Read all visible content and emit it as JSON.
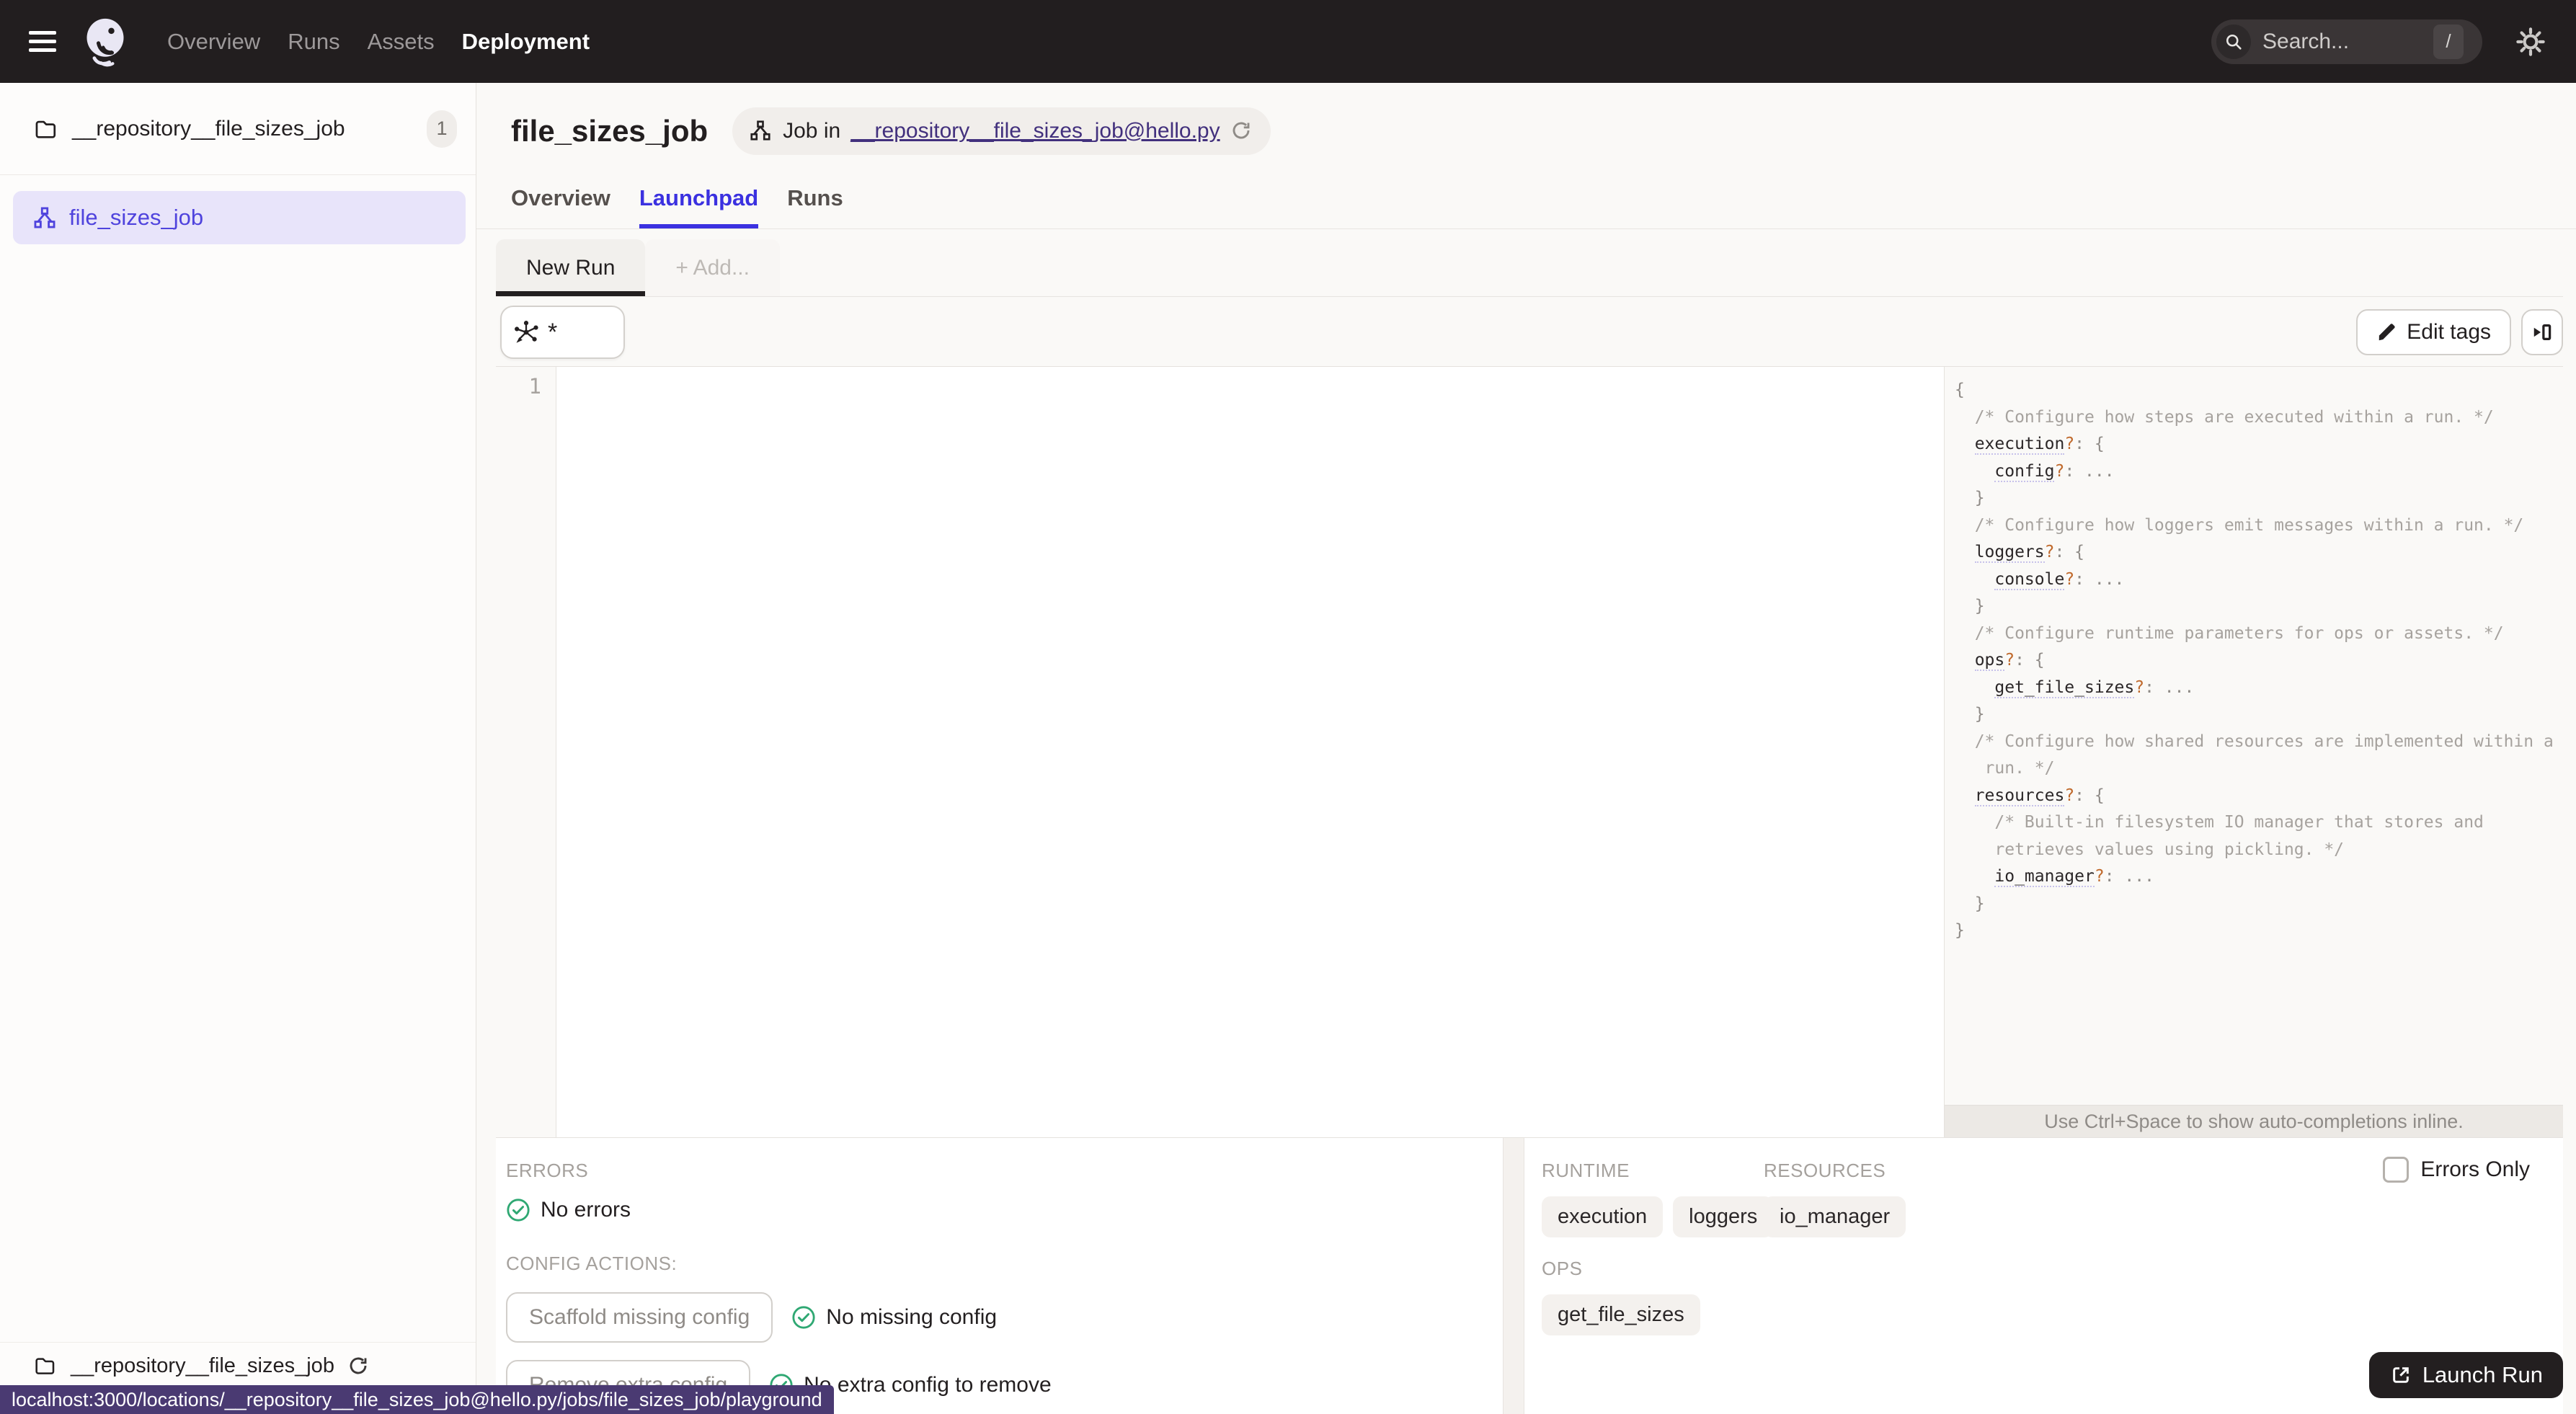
{
  "colors": {
    "topnav_bg": "#221E1F",
    "page_bg": "#FAF9F7",
    "border": "#E5E2DE",
    "accent": "#3B31E0",
    "blurple": "#4F43DD",
    "selected_bg": "#E8E4FA",
    "link_purple": "#42307D",
    "statusbar_bg": "#4A3A72",
    "success": "#2FA873",
    "dark": "#231F20",
    "muted": "#A5A19D",
    "code_comment": "#A6A29E",
    "code_punct": "#8F8B87",
    "code_qmark": "#C06A2D"
  },
  "topnav": {
    "items": [
      {
        "label": "Overview"
      },
      {
        "label": "Runs"
      },
      {
        "label": "Assets"
      },
      {
        "label": "Deployment"
      }
    ],
    "search": {
      "placeholder": "Search...",
      "shortcut": "/"
    }
  },
  "sidebar": {
    "repository": {
      "name": "__repository__file_sizes_job",
      "count": "1"
    },
    "job": {
      "name": "file_sizes_job"
    },
    "footer_repository": "__repository__file_sizes_job"
  },
  "header": {
    "title": "file_sizes_job",
    "job_pill": {
      "prefix": "Job in",
      "link": "__repository__file_sizes_job@hello.py"
    }
  },
  "tabs": [
    {
      "label": "Overview"
    },
    {
      "label": "Launchpad"
    },
    {
      "label": "Runs"
    }
  ],
  "launchpad": {
    "config_tabs": [
      {
        "label": "New Run"
      },
      {
        "label": "+ Add..."
      }
    ],
    "op_selector": "*",
    "edit_tags": "Edit tags",
    "editor": {
      "first_line_number": "1"
    },
    "schema_panel": {
      "hint": "Use Ctrl+Space to show auto-completions inline.",
      "lines": [
        {
          "i": 0,
          "toks": [
            [
              "p",
              "{"
            ]
          ]
        },
        {
          "i": 2,
          "toks": [
            [
              "c",
              "/* Configure how steps are executed within a run. */"
            ]
          ]
        },
        {
          "i": 2,
          "toks": [
            [
              "k",
              "execution"
            ],
            [
              "q",
              "?"
            ],
            [
              "p",
              ": {"
            ]
          ]
        },
        {
          "i": 4,
          "toks": [
            [
              "k",
              "config"
            ],
            [
              "q",
              "?"
            ],
            [
              "p",
              ": ..."
            ]
          ]
        },
        {
          "i": 2,
          "toks": [
            [
              "p",
              "}"
            ]
          ]
        },
        {
          "i": 2,
          "toks": [
            [
              "c",
              "/* Configure how loggers emit messages within a run. */"
            ]
          ]
        },
        {
          "i": 2,
          "toks": [
            [
              "k",
              "loggers"
            ],
            [
              "q",
              "?"
            ],
            [
              "p",
              ": {"
            ]
          ]
        },
        {
          "i": 4,
          "toks": [
            [
              "k",
              "console"
            ],
            [
              "q",
              "?"
            ],
            [
              "p",
              ": ..."
            ]
          ]
        },
        {
          "i": 2,
          "toks": [
            [
              "p",
              "}"
            ]
          ]
        },
        {
          "i": 2,
          "toks": [
            [
              "c",
              "/* Configure runtime parameters for ops or assets. */"
            ]
          ]
        },
        {
          "i": 2,
          "toks": [
            [
              "k",
              "ops"
            ],
            [
              "q",
              "?"
            ],
            [
              "p",
              ": {"
            ]
          ]
        },
        {
          "i": 4,
          "toks": [
            [
              "k",
              "get_file_sizes"
            ],
            [
              "q",
              "?"
            ],
            [
              "p",
              ": ..."
            ]
          ]
        },
        {
          "i": 2,
          "toks": [
            [
              "p",
              "}"
            ]
          ]
        },
        {
          "i": 2,
          "toks": [
            [
              "c",
              "/* Configure how shared resources are implemented within a"
            ]
          ]
        },
        {
          "i": 3,
          "toks": [
            [
              "c",
              "run. */"
            ]
          ]
        },
        {
          "i": 2,
          "toks": [
            [
              "k",
              "resources"
            ],
            [
              "q",
              "?"
            ],
            [
              "p",
              ": {"
            ]
          ]
        },
        {
          "i": 4,
          "toks": [
            [
              "c",
              "/* Built-in filesystem IO manager that stores and"
            ]
          ]
        },
        {
          "i": 4,
          "toks": [
            [
              "c",
              "retrieves values using pickling. */"
            ]
          ]
        },
        {
          "i": 4,
          "toks": [
            [
              "k",
              "io_manager"
            ],
            [
              "q",
              "?"
            ],
            [
              "p",
              ": ..."
            ]
          ]
        },
        {
          "i": 2,
          "toks": [
            [
              "p",
              "}"
            ]
          ]
        },
        {
          "i": 0,
          "toks": [
            [
              "p",
              "}"
            ]
          ]
        }
      ]
    },
    "bottom": {
      "errors_label": "ERRORS",
      "no_errors": "No errors",
      "config_actions_label": "CONFIG ACTIONS:",
      "scaffold_button": "Scaffold missing config",
      "no_missing_config": "No missing config",
      "remove_button": "Remove extra config",
      "no_extra_config": "No extra config to remove",
      "runtime_label": "RUNTIME",
      "runtime_tags": [
        "execution",
        "loggers"
      ],
      "resources_label": "RESOURCES",
      "resources_tags": [
        "io_manager"
      ],
      "ops_label": "OPS",
      "ops_tags": [
        "get_file_sizes"
      ],
      "errors_only": "Errors Only",
      "launch_button": "Launch Run"
    }
  },
  "statusbar": {
    "url": "localhost:3000/locations/__repository__file_sizes_job@hello.py/jobs/file_sizes_job/playground"
  }
}
